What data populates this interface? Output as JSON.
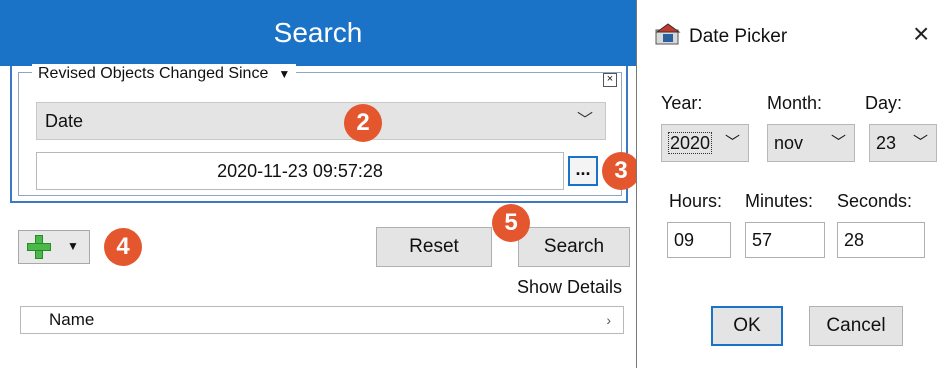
{
  "search_panel": {
    "title": "Search",
    "criteria_label": "Revised Objects Changed Since",
    "criteria_close": "×",
    "date_type": "Date",
    "date_value": "2020-11-23 09:57:28",
    "ellipsis_label": "...",
    "reset_label": "Reset",
    "search_label": "Search",
    "show_details_label": "Show Details",
    "name_column": "Name"
  },
  "badges": [
    "2",
    "3",
    "4",
    "5"
  ],
  "date_picker": {
    "title": "Date Picker",
    "close_label": "×",
    "year_label": "Year:",
    "month_label": "Month:",
    "day_label": "Day:",
    "year_value": "2020",
    "month_value": "nov",
    "day_value": "23",
    "hours_label": "Hours:",
    "minutes_label": "Minutes:",
    "seconds_label": "Seconds:",
    "hours_value": "09",
    "minutes_value": "57",
    "seconds_value": "28",
    "ok_label": "OK",
    "cancel_label": "Cancel"
  },
  "colors": {
    "header_blue": "#1a73c6",
    "badge_orange": "#e4572e",
    "button_gray": "#e4e4e4"
  },
  "icons": [
    "chevron-down-icon",
    "add-icon",
    "close-icon",
    "date-picker-app-icon",
    "sort-arrow-icon"
  ]
}
